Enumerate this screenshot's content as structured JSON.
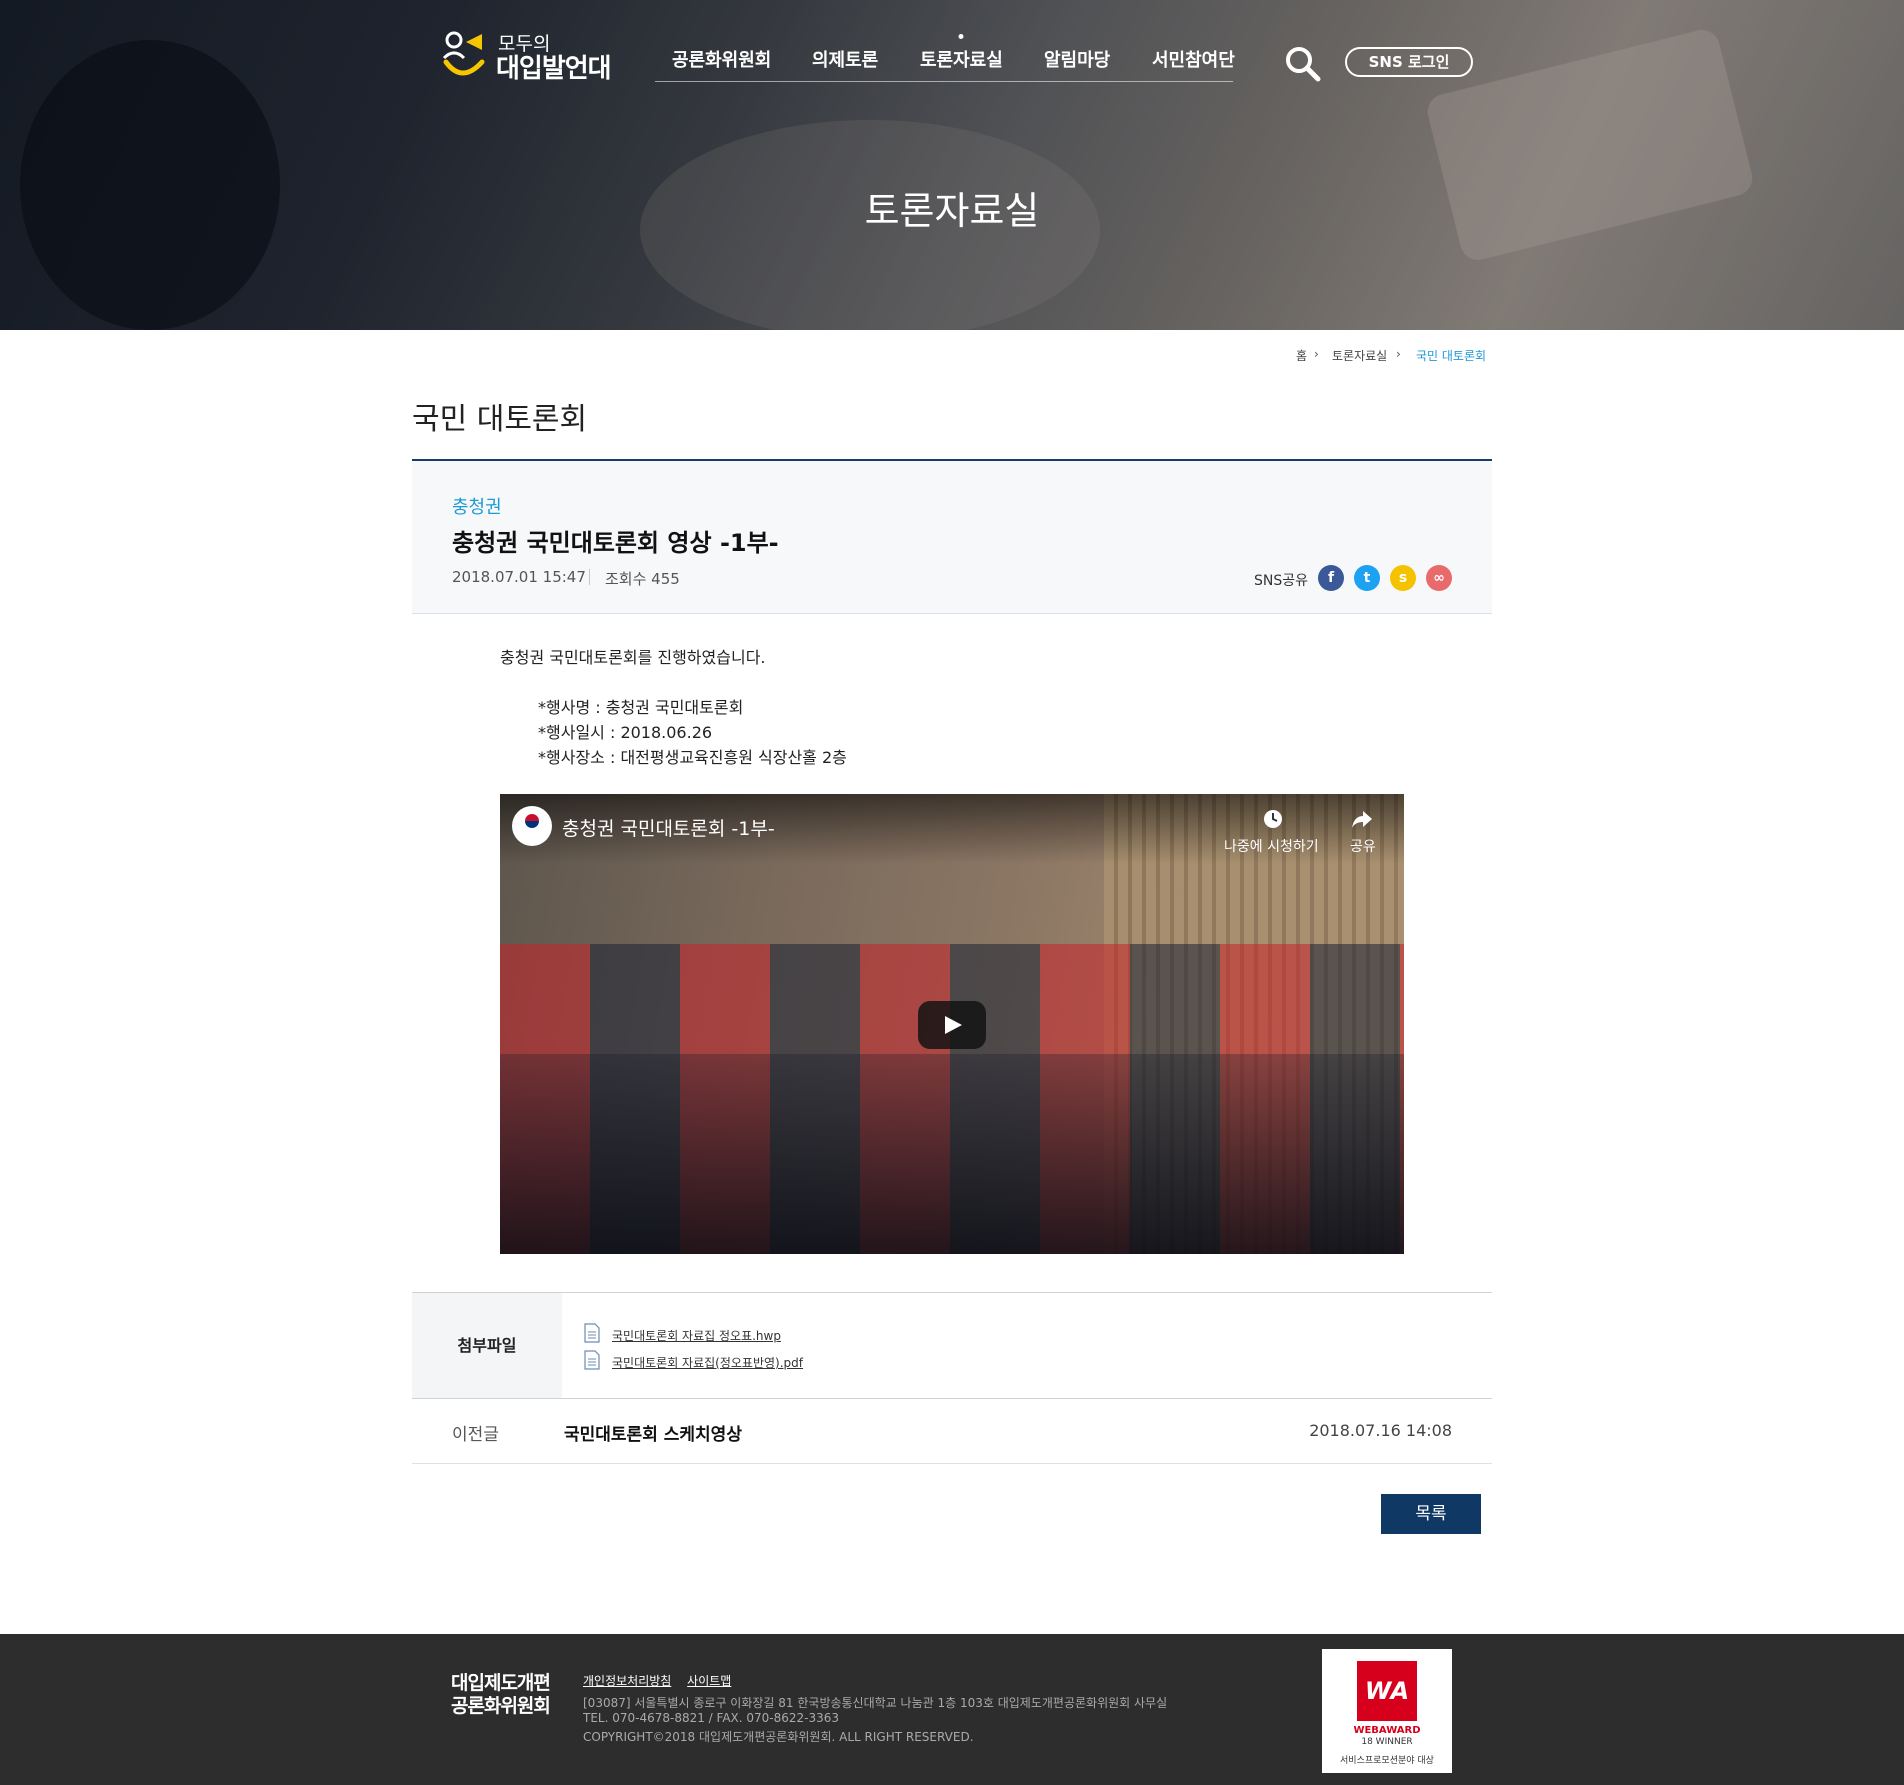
{
  "header": {
    "logo": {
      "line1": "모두의",
      "line2": "대입발언대"
    },
    "nav": [
      {
        "label": "공론화위원회"
      },
      {
        "label": "의제토론"
      },
      {
        "label": "토론자료실"
      },
      {
        "label": "알림마당"
      },
      {
        "label": "서민참여단"
      }
    ],
    "active_nav": "토론자료실",
    "sns_login": "SNS 로그인",
    "hero_title": "토론자료실"
  },
  "breadcrumb": {
    "home": "홈",
    "section": "토론자료실",
    "current": "국민 대토론회"
  },
  "page_title": "국민 대토론회",
  "article": {
    "category": "충청권",
    "subject": "충청권 국민대토론회 영상 -1부-",
    "date": "2018.07.01 15:47",
    "views": "조회수 455",
    "sns_label": "SNS공유",
    "sns_icons": [
      "facebook-icon",
      "twitter-icon",
      "kakaostory-icon",
      "link-icon"
    ]
  },
  "content": {
    "intro": "충청권 국민대토론회를 진행하였습니다.",
    "event_name": "*행사명 : 충청권 국민대토론회",
    "event_date": "*행사일시 : 2018.06.26",
    "event_place": "*행사장소 : 대전평생교육진흥원 식장산홀 2층"
  },
  "video": {
    "title": "충청권 국민대토론회 -1부-",
    "watch_later": "나중에 시청하기",
    "share": "공유"
  },
  "attachments": {
    "label": "첨부파일",
    "files": [
      {
        "name": "국민대토론회 자료집 정오표.hwp"
      },
      {
        "name": "국민대토론회 자료집(정오표반영).pdf"
      }
    ]
  },
  "prev_post": {
    "label": "이전글",
    "title": "국민대토론회 스케치영상",
    "date": "2018.07.16 14:08"
  },
  "list_button": "목록",
  "footer": {
    "org_line1": "대입제도개편",
    "org_line2": "공론화위원회",
    "link_privacy": "개인정보처리방침",
    "link_sitemap": "사이트맵",
    "address": "[03087] 서울특별시 종로구 이화장길 81 한국방송통신대학교 나눔관 1층 103호 대입제도개편공론화위원회 사무실",
    "tel": "TEL. 070-4678-8821 / FAX. 070-8622-3363",
    "copyright": "COPYRIGHT©2018 대입제도개편공론화위원회. ALL RIGHT RESERVED.",
    "award": {
      "mark": "WA",
      "line1": "WEBAWARD",
      "line2": "18 WINNER",
      "line3": "서비스프로모션분야 대상"
    }
  },
  "colors": {
    "accent": "#1e9ad6",
    "navy": "#0f3865",
    "footer_bg": "#2d2d2d"
  }
}
